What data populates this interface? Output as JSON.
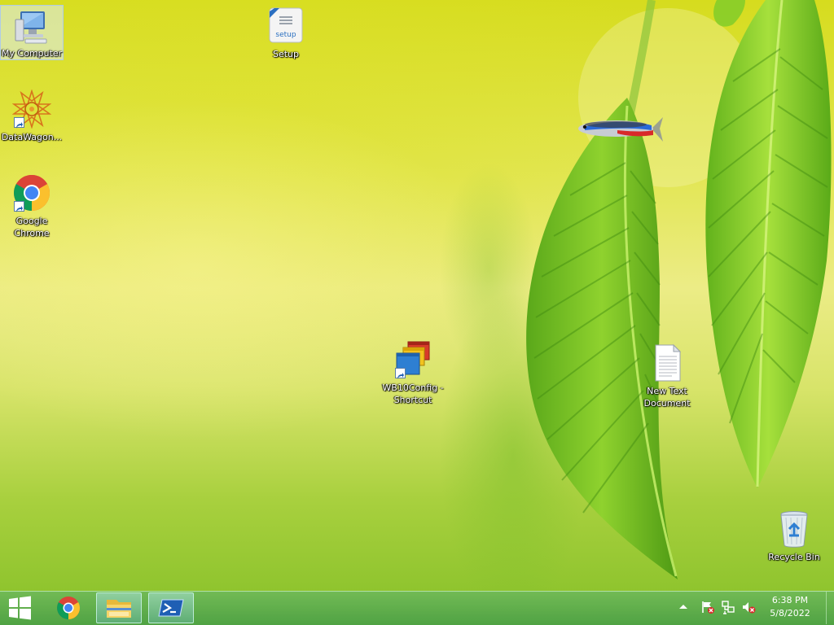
{
  "desktop": {
    "icons": {
      "my_computer": "My Computer",
      "setup": "Setup",
      "datawagon": "DataWagon...",
      "chrome": "Google Chrome",
      "wb10config": "WB10Config - Shortcut",
      "new_text": "New Text Document",
      "recycle_bin": "Recycle Bin"
    },
    "setup_icon_text": "setup"
  },
  "taskbar": {
    "start_icon": "windows-logo-icon",
    "pinned": [
      "chrome-icon",
      "file-explorer-icon",
      "powershell-icon"
    ],
    "tray": {
      "icons": [
        "show-hidden-icons-chevron",
        "action-center-flag-icon",
        "network-icon",
        "volume-muted-icon"
      ],
      "time": "6:38 PM",
      "date": "5/8/2022"
    }
  },
  "colors": {
    "wallpaper_top": "#d6dc1e",
    "wallpaper_mid": "#ecec86",
    "wallpaper_bottom": "#86c028",
    "taskbar": "#5aab55"
  }
}
